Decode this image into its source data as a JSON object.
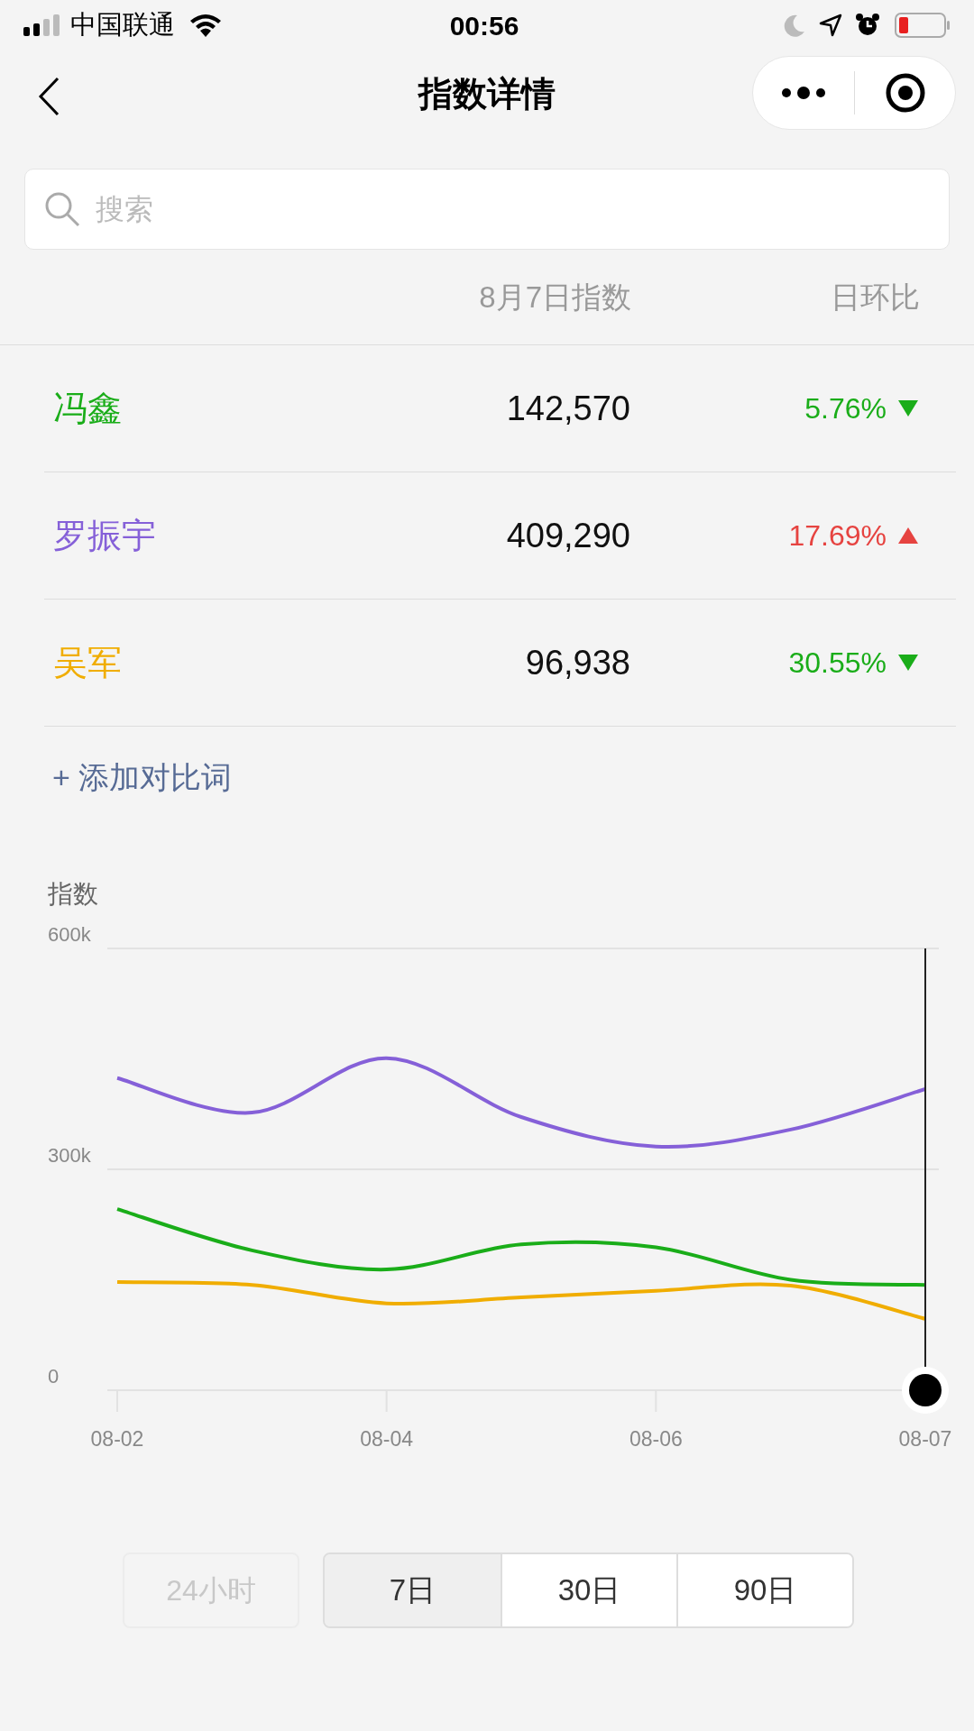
{
  "status_bar": {
    "carrier": "中国联通",
    "time": "00:56"
  },
  "nav": {
    "title": "指数详情"
  },
  "search": {
    "placeholder": "搜索"
  },
  "table": {
    "columns": [
      "8月7日指数",
      "日环比"
    ],
    "rows": [
      {
        "name": "冯鑫",
        "color": "#1aad19",
        "value": "142,570",
        "change": "5.76%",
        "kind": "down"
      },
      {
        "name": "罗振宇",
        "color": "#8560d8",
        "value": "409,290",
        "change": "17.69%",
        "kind": "up"
      },
      {
        "name": "吴军",
        "color": "#f0ad00",
        "value": "96,938",
        "change": "30.55%",
        "kind": "down"
      }
    ]
  },
  "add_link": "+ 添加对比词",
  "chart_data": {
    "type": "line",
    "ylabel": "指数",
    "categories": [
      "08-02",
      null,
      "08-04",
      null,
      "08-06",
      null,
      "08-07"
    ],
    "ylim": [
      0,
      600000
    ],
    "yticks": [
      {
        "value": 0,
        "label": "0"
      },
      {
        "value": 300000,
        "label": "300k"
      },
      {
        "value": 600000,
        "label": "600k"
      }
    ],
    "series": [
      {
        "color": "#1aad19",
        "values": [
          246000,
          190000,
          164000,
          198000,
          194000,
          150000,
          143000
        ]
      },
      {
        "color": "#8560d8",
        "values": [
          424000,
          377000,
          451000,
          371000,
          331000,
          354000,
          409000
        ]
      },
      {
        "color": "#f0ad00",
        "values": [
          147000,
          143000,
          118000,
          126000,
          135000,
          142000,
          97000
        ]
      }
    ],
    "ref_lines": [
      {
        "axis": "y",
        "value": 300000,
        "color": "#e2e2e2"
      },
      {
        "axis": "x",
        "value": "08-07",
        "color": "#222222"
      }
    ]
  },
  "range_buttons": [
    {
      "label": "24小时",
      "selected": false,
      "disabled": true
    },
    {
      "label": "7日",
      "selected": true,
      "disabled": false
    },
    {
      "label": "30日",
      "selected": false,
      "disabled": false
    },
    {
      "label": "90日",
      "selected": false,
      "disabled": false
    }
  ]
}
